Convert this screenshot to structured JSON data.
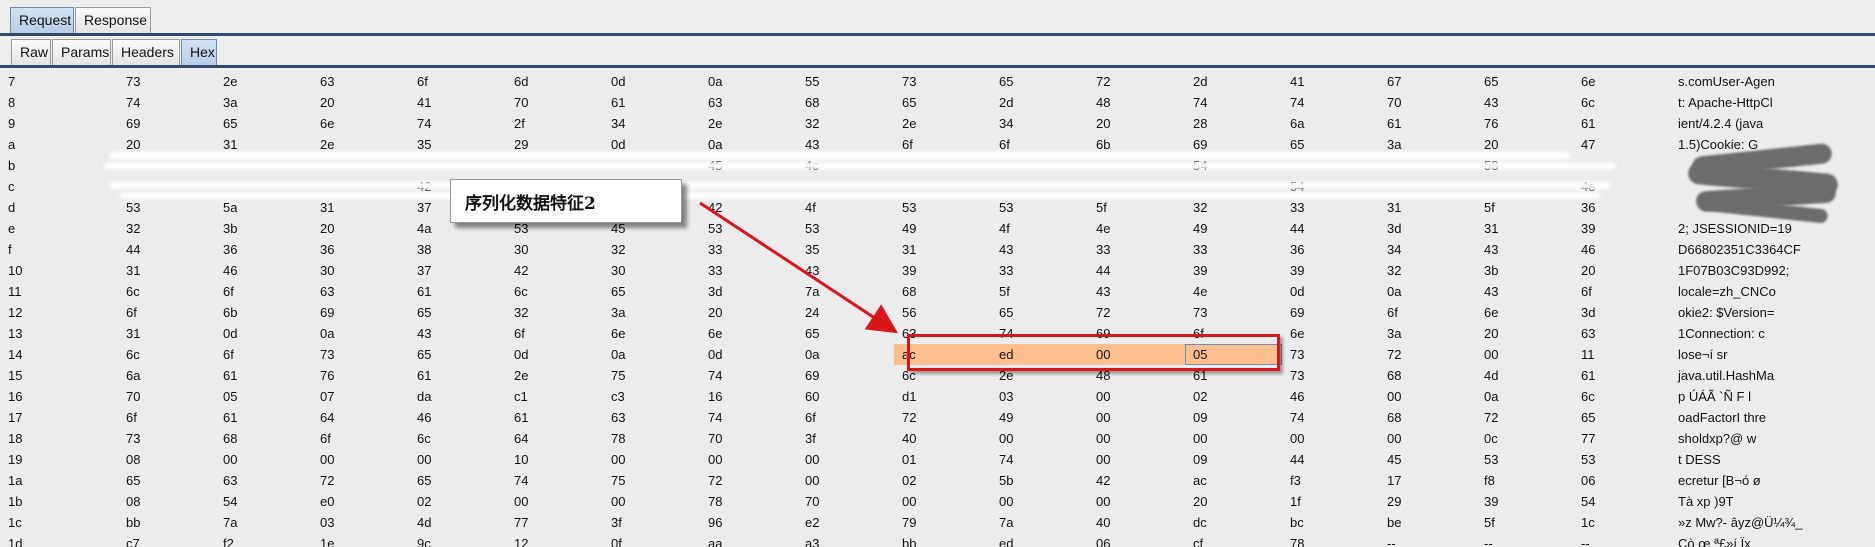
{
  "tabs": {
    "top": [
      {
        "label": "Request",
        "selected": true
      },
      {
        "label": "Response",
        "selected": false
      }
    ],
    "sub": [
      {
        "label": "Raw",
        "selected": false
      },
      {
        "label": "Params",
        "selected": false
      },
      {
        "label": "Headers",
        "selected": false
      },
      {
        "label": "Hex",
        "selected": true
      }
    ]
  },
  "hex": {
    "rows": [
      {
        "offset": "7",
        "bytes": [
          "73",
          "2e",
          "63",
          "6f",
          "6d",
          "0d",
          "0a",
          "55",
          "73",
          "65",
          "72",
          "2d",
          "41",
          "67",
          "65",
          "6e"
        ],
        "ascii": "s.comUser-Agen"
      },
      {
        "offset": "8",
        "bytes": [
          "74",
          "3a",
          "20",
          "41",
          "70",
          "61",
          "63",
          "68",
          "65",
          "2d",
          "48",
          "74",
          "74",
          "70",
          "43",
          "6c"
        ],
        "ascii": "t: Apache-HttpCl"
      },
      {
        "offset": "9",
        "bytes": [
          "69",
          "65",
          "6e",
          "74",
          "2f",
          "34",
          "2e",
          "32",
          "2e",
          "34",
          "20",
          "28",
          "6a",
          "61",
          "76",
          "61"
        ],
        "ascii": "ient/4.2.4 (java"
      },
      {
        "offset": "a",
        "bytes": [
          "20",
          "31",
          "2e",
          "35",
          "29",
          "0d",
          "0a",
          "43",
          "6f",
          "6f",
          "6b",
          "69",
          "65",
          "3a",
          "20",
          "47"
        ],
        "ascii": " 1.5)Cookie: G"
      },
      {
        "offset": "b",
        "bytes": [
          "",
          "",
          "",
          "",
          "",
          "",
          "45",
          "4c",
          "",
          "",
          "",
          "54",
          "",
          "",
          "53",
          ""
        ],
        "ascii": ""
      },
      {
        "offset": "c",
        "bytes": [
          "",
          "",
          "",
          "42",
          "",
          "",
          "",
          "",
          "",
          "",
          "",
          "",
          "54",
          "",
          "",
          "4e"
        ],
        "ascii": ""
      },
      {
        "offset": "d",
        "bytes": [
          "53",
          "5a",
          "31",
          "37",
          "",
          "",
          "42",
          "4f",
          "53",
          "53",
          "5f",
          "32",
          "33",
          "31",
          "5f",
          "36"
        ],
        "ascii": ""
      },
      {
        "offset": "e",
        "bytes": [
          "32",
          "3b",
          "20",
          "4a",
          "53",
          "45",
          "53",
          "53",
          "49",
          "4f",
          "4e",
          "49",
          "44",
          "3d",
          "31",
          "39"
        ],
        "ascii": "2; JSESSIONID=19"
      },
      {
        "offset": "f",
        "bytes": [
          "44",
          "36",
          "36",
          "38",
          "30",
          "32",
          "33",
          "35",
          "31",
          "43",
          "33",
          "33",
          "36",
          "34",
          "43",
          "46"
        ],
        "ascii": "D66802351C3364CF"
      },
      {
        "offset": "10",
        "bytes": [
          "31",
          "46",
          "30",
          "37",
          "42",
          "30",
          "33",
          "43",
          "39",
          "33",
          "44",
          "39",
          "39",
          "32",
          "3b",
          "20"
        ],
        "ascii": "1F07B03C93D992;"
      },
      {
        "offset": "11",
        "bytes": [
          "6c",
          "6f",
          "63",
          "61",
          "6c",
          "65",
          "3d",
          "7a",
          "68",
          "5f",
          "43",
          "4e",
          "0d",
          "0a",
          "43",
          "6f"
        ],
        "ascii": "locale=zh_CNCo"
      },
      {
        "offset": "12",
        "bytes": [
          "6f",
          "6b",
          "69",
          "65",
          "32",
          "3a",
          "20",
          "24",
          "56",
          "65",
          "72",
          "73",
          "69",
          "6f",
          "6e",
          "3d"
        ],
        "ascii": "okie2: $Version="
      },
      {
        "offset": "13",
        "bytes": [
          "31",
          "0d",
          "0a",
          "43",
          "6f",
          "6e",
          "6e",
          "65",
          "63",
          "74",
          "69",
          "6f",
          "6e",
          "3a",
          "20",
          "63"
        ],
        "ascii": "1Connection: c"
      },
      {
        "offset": "14",
        "bytes": [
          "6c",
          "6f",
          "73",
          "65",
          "0d",
          "0a",
          "0d",
          "0a",
          "ac",
          "ed",
          "00",
          "05",
          "73",
          "72",
          "00",
          "11"
        ],
        "ascii": "lose¬í   sr"
      },
      {
        "offset": "15",
        "bytes": [
          "6a",
          "61",
          "76",
          "61",
          "2e",
          "75",
          "74",
          "69",
          "6c",
          "2e",
          "48",
          "61",
          "73",
          "68",
          "4d",
          "61"
        ],
        "ascii": "java.util.HashMa"
      },
      {
        "offset": "16",
        "bytes": [
          "70",
          "05",
          "07",
          "da",
          "c1",
          "c3",
          "16",
          "60",
          "d1",
          "03",
          "00",
          "02",
          "46",
          "00",
          "0a",
          "6c"
        ],
        "ascii": "p  ÚÁÃ `Ñ    F l"
      },
      {
        "offset": "17",
        "bytes": [
          "6f",
          "61",
          "64",
          "46",
          "61",
          "63",
          "74",
          "6f",
          "72",
          "49",
          "00",
          "09",
          "74",
          "68",
          "72",
          "65"
        ],
        "ascii": "oadFactorI thre"
      },
      {
        "offset": "18",
        "bytes": [
          "73",
          "68",
          "6f",
          "6c",
          "64",
          "78",
          "70",
          "3f",
          "40",
          "00",
          "00",
          "00",
          "00",
          "00",
          "0c",
          "77"
        ],
        "ascii": "sholdxp?@       w"
      },
      {
        "offset": "19",
        "bytes": [
          "08",
          "00",
          "00",
          "00",
          "10",
          "00",
          "00",
          "00",
          "01",
          "74",
          "00",
          "09",
          "44",
          "45",
          "53",
          "53"
        ],
        "ascii": "          t DESS"
      },
      {
        "offset": "1a",
        "bytes": [
          "65",
          "63",
          "72",
          "65",
          "74",
          "75",
          "72",
          "00",
          "02",
          "5b",
          "42",
          "ac",
          "f3",
          "17",
          "f8",
          "06"
        ],
        "ascii": "ecretur   [B¬ó ø"
      },
      {
        "offset": "1b",
        "bytes": [
          "08",
          "54",
          "e0",
          "02",
          "00",
          "00",
          "78",
          "70",
          "00",
          "00",
          "00",
          "20",
          "1f",
          "29",
          "39",
          "54"
        ],
        "ascii": " Tà     xp      )9T"
      },
      {
        "offset": "1c",
        "bytes": [
          "bb",
          "7a",
          "03",
          "4d",
          "77",
          "3f",
          "96",
          "e2",
          "79",
          "7a",
          "40",
          "dc",
          "bc",
          "be",
          "5f",
          "1c"
        ],
        "ascii": "»z Mw?- âyz@Ü¼¾_"
      },
      {
        "offset": "1d",
        "bytes": [
          "c7",
          "f2",
          "1e",
          "9c",
          "12",
          "0f",
          "aa",
          "a3",
          "bb",
          "ed",
          "06",
          "cf",
          "78",
          "--",
          "--",
          "--"
        ],
        "ascii": "Çò  œ  ª£»í Ïx"
      }
    ]
  },
  "annotation": {
    "label": "序列化数据特征2",
    "color": "#d8161b"
  },
  "colors": {
    "highlight": "#fdbf8d",
    "selection_outline": "#6b8fbf",
    "tab_rule": "#2e4b6e"
  }
}
